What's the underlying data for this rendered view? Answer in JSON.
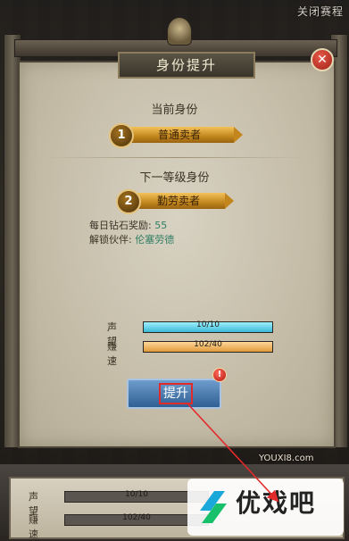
{
  "top_right_label": "关闭赛程",
  "dialog": {
    "title": "身份提升",
    "close_symbol": "✕",
    "current": {
      "heading": "当前身份",
      "rank_number": "1",
      "rank_name": "普通卖者"
    },
    "next": {
      "heading": "下一等级身份",
      "rank_number": "2",
      "rank_name": "勤劳卖者"
    },
    "reward": {
      "daily_diamond_label": "每日钻石奖励:",
      "daily_diamond_value": "55",
      "unlock_partner_label": "解锁伙伴:",
      "unlock_partner_value": "伦塞劳德"
    },
    "stats": [
      {
        "label": "声望",
        "text": "10/10",
        "fill": 1.0
      },
      {
        "label": "赚速",
        "text": "102/40",
        "fill": 1.0
      }
    ],
    "upgrade_label": "提升",
    "alert_symbol": "!"
  },
  "bottom": {
    "stats": [
      {
        "label": "声望",
        "text": "10/10"
      },
      {
        "label": "赚速",
        "text": "102/40"
      }
    ]
  },
  "watermark": {
    "text": "优戏吧",
    "url": "YOUXI8.com"
  },
  "colors": {
    "highlight_red": "#e32a2a",
    "gold": "#c2861d",
    "teal_value": "#2f7e63"
  }
}
